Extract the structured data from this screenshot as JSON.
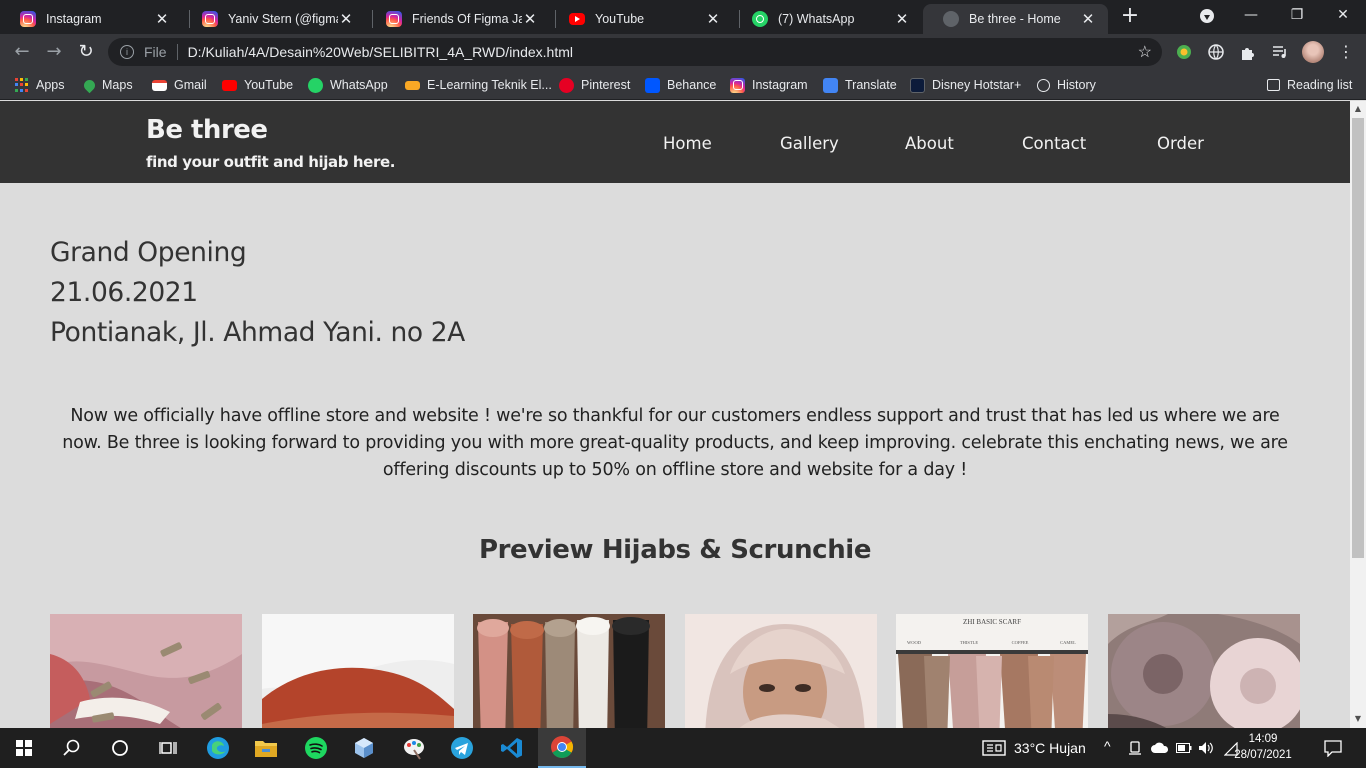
{
  "browser": {
    "tabs": [
      {
        "title": "Instagram",
        "icon": "instagram-icon"
      },
      {
        "title": "Yaniv Stern (@figma_t",
        "icon": "instagram-icon"
      },
      {
        "title": "Friends Of Figma Jakar",
        "icon": "instagram-icon"
      },
      {
        "title": "YouTube",
        "icon": "youtube-icon"
      },
      {
        "title": "(7) WhatsApp",
        "icon": "whatsapp-icon"
      },
      {
        "title": "Be three - Home",
        "icon": "globe-icon",
        "active": true
      }
    ],
    "address": {
      "scheme_label": "File",
      "url": "D:/Kuliah/4A/Desain%20Web/SELIBITRI_4A_RWD/index.html"
    },
    "bookmarks": [
      {
        "label": "Apps",
        "icon": "apps-grid-icon"
      },
      {
        "label": "Maps",
        "icon": "maps-icon"
      },
      {
        "label": "Gmail",
        "icon": "gmail-icon"
      },
      {
        "label": "YouTube",
        "icon": "youtube-icon"
      },
      {
        "label": "WhatsApp",
        "icon": "whatsapp-icon"
      },
      {
        "label": "E-Learning Teknik El...",
        "icon": "elearning-icon"
      },
      {
        "label": "Pinterest",
        "icon": "pinterest-icon"
      },
      {
        "label": "Behance",
        "icon": "behance-icon"
      },
      {
        "label": "Instagram",
        "icon": "instagram-icon"
      },
      {
        "label": "Translate",
        "icon": "translate-icon"
      },
      {
        "label": "Disney Hotstar+",
        "icon": "hotstar-icon"
      },
      {
        "label": "History",
        "icon": "history-icon"
      }
    ],
    "reading_list_label": "Reading list"
  },
  "site": {
    "brand": {
      "title": "Be three",
      "tagline": "find your outfit and hijab here."
    },
    "nav": [
      "Home",
      "Gallery",
      "About",
      "Contact",
      "Order"
    ],
    "announcement": {
      "line1": "Grand Opening",
      "line2": "21.06.2021",
      "line3": "Pontianak, Jl. Ahmad Yani. no 2A"
    },
    "description": "Now we officially have offline store and website ! we're so thankful for our customers endless support and trust that has led us where we are now. Be three is looking forward to providing you with more great-quality products, and keep improving. celebrate this enchating news, we are offering discounts up to 50% on offline store and website for a day !",
    "preview_title": "Preview Hijabs & Scrunchie",
    "photo_texts": {
      "scarf_brand": "ZHI BASIC SCARF",
      "scarf_colors": [
        "WOOD",
        "THISTLE",
        "COFFEE",
        "CAMEL"
      ]
    }
  },
  "taskbar": {
    "weather": "33°C  Hujan",
    "time": "14:09",
    "date": "28/07/2021"
  },
  "colors": {
    "header_bg": "#333333",
    "page_bg": "#dcdcdc",
    "chrome_dark": "#202124",
    "chrome_mid": "#35363a"
  }
}
